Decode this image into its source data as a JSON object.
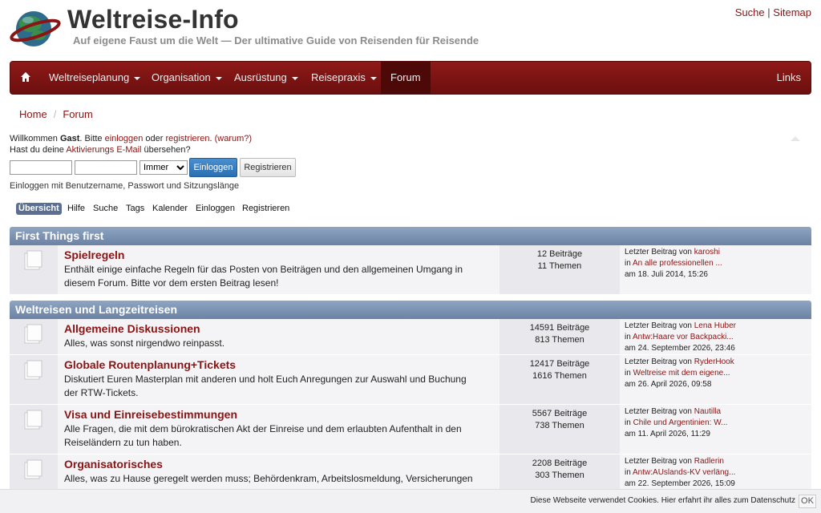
{
  "header": {
    "title": "Weltreise-Info",
    "slogan": "Auf eigene Faust um die Welt — Der ultimative Guide von Reisenden für Reisende",
    "links": [
      {
        "label": "Suche"
      },
      {
        "label": "Sitemap"
      }
    ],
    "separator": "|"
  },
  "nav": {
    "items": [
      {
        "label": "Weltreiseplanung"
      },
      {
        "label": "Organisation"
      },
      {
        "label": "Ausrüstung"
      },
      {
        "label": "Reisepraxis"
      }
    ],
    "active": "Forum",
    "right": "Links"
  },
  "breadcrumb": {
    "items": [
      "Home",
      "Forum"
    ],
    "sep": "/"
  },
  "welcome": {
    "w1": "Willkommen ",
    "guest": "Gast",
    "w2": ". Bitte ",
    "login_link": "einloggen",
    "w3": " oder ",
    "register_link": "registrieren",
    "w4": ". ",
    "why": "(warum?)",
    "w5": "Hast du deine ",
    "activation_link": "Aktivierungs E-Mail",
    "w6": " übersehen?"
  },
  "login": {
    "duration_selected": "Immer",
    "login_button": "Einloggen",
    "register_button": "Registrieren",
    "hint": "Einloggen mit Benutzername, Passwort und Sitzungslänge"
  },
  "tabs": [
    "Übersicht",
    "Hilfe",
    "Suche",
    "Tags",
    "Kalender",
    "Einloggen",
    "Registrieren"
  ],
  "categories": [
    {
      "name": "First Things first",
      "boards": [
        {
          "title": "Spielregeln",
          "desc": "Enthält einige einfache Regeln für das Posten von Beiträgen und den allgemeinen Umgang in diesem Forum. Bitte vor dem ersten Beitrag lesen!",
          "posts": "12 Beiträge",
          "topics": "11 Themen",
          "last_by_label": "Letzter Beitrag von ",
          "last_by": "karoshi",
          "in_label": "in ",
          "last_topic": "An alle professionellen ...",
          "last_date": "am 18. Juli 2014, 15:26"
        }
      ]
    },
    {
      "name": "Weltreisen und Langzeitreisen",
      "boards": [
        {
          "title": "Allgemeine Diskussionen",
          "desc": "Alles, was sonst nirgendwo reinpasst.",
          "posts": "14591 Beiträge",
          "topics": "813 Themen",
          "last_by_label": "Letzter Beitrag von ",
          "last_by": "Lena Huber",
          "in_label": "in ",
          "last_topic": "Antw:Haare vor Backpacki...",
          "last_date": "am 24. September 2026, 23:46"
        },
        {
          "title": "Globale Routenplanung+Tickets",
          "desc": "Diskutiert Euren Masterplan mit anderen und holt Euch Anregungen zur Auswahl und Buchung der RTW-Tickets.",
          "posts": "12417 Beiträge",
          "topics": "1616 Themen",
          "last_by_label": "Letzter Beitrag von ",
          "last_by": "RyderHook",
          "in_label": "in ",
          "last_topic": "Weltreise mit dem eigene...",
          "last_date": "am 26. April 2026, 09:58"
        },
        {
          "title": "Visa und Einreisebestimmungen",
          "desc": "Alle Fragen, die mit dem bürokratischen Akt der Einreise und dem erlaubten Aufenthalt in den Reiseländern zu tun haben.",
          "posts": "5567 Beiträge",
          "topics": "738 Themen",
          "last_by_label": "Letzter Beitrag von ",
          "last_by": "Nautilla",
          "in_label": "in ",
          "last_topic": "Chile und Argentinien: W...",
          "last_date": "am 11. April 2026, 11:29"
        },
        {
          "title": "Organisatorisches",
          "desc": "Alles, was zu Hause geregelt werden muss; Behördenkram, Arbeitslosmeldung, Versicherungen etc.",
          "posts": "2208 Beiträge",
          "topics": "303 Themen",
          "last_by_label": "Letzter Beitrag von ",
          "last_by": "Radlerin",
          "in_label": "in ",
          "last_topic": "Antw:AUslands-KV verläng...",
          "last_date": "am 22. September 2026, 15:09"
        }
      ]
    }
  ],
  "cookie": {
    "text": "Diese Webseite verwendet Cookies. ",
    "link": "Hier erfahrt ihr alles zum Datenschutz",
    "ok": "OK"
  },
  "colors": {
    "brand": "#8a1414",
    "nav_bg": "#7c1514",
    "category": "#7a8fae"
  }
}
